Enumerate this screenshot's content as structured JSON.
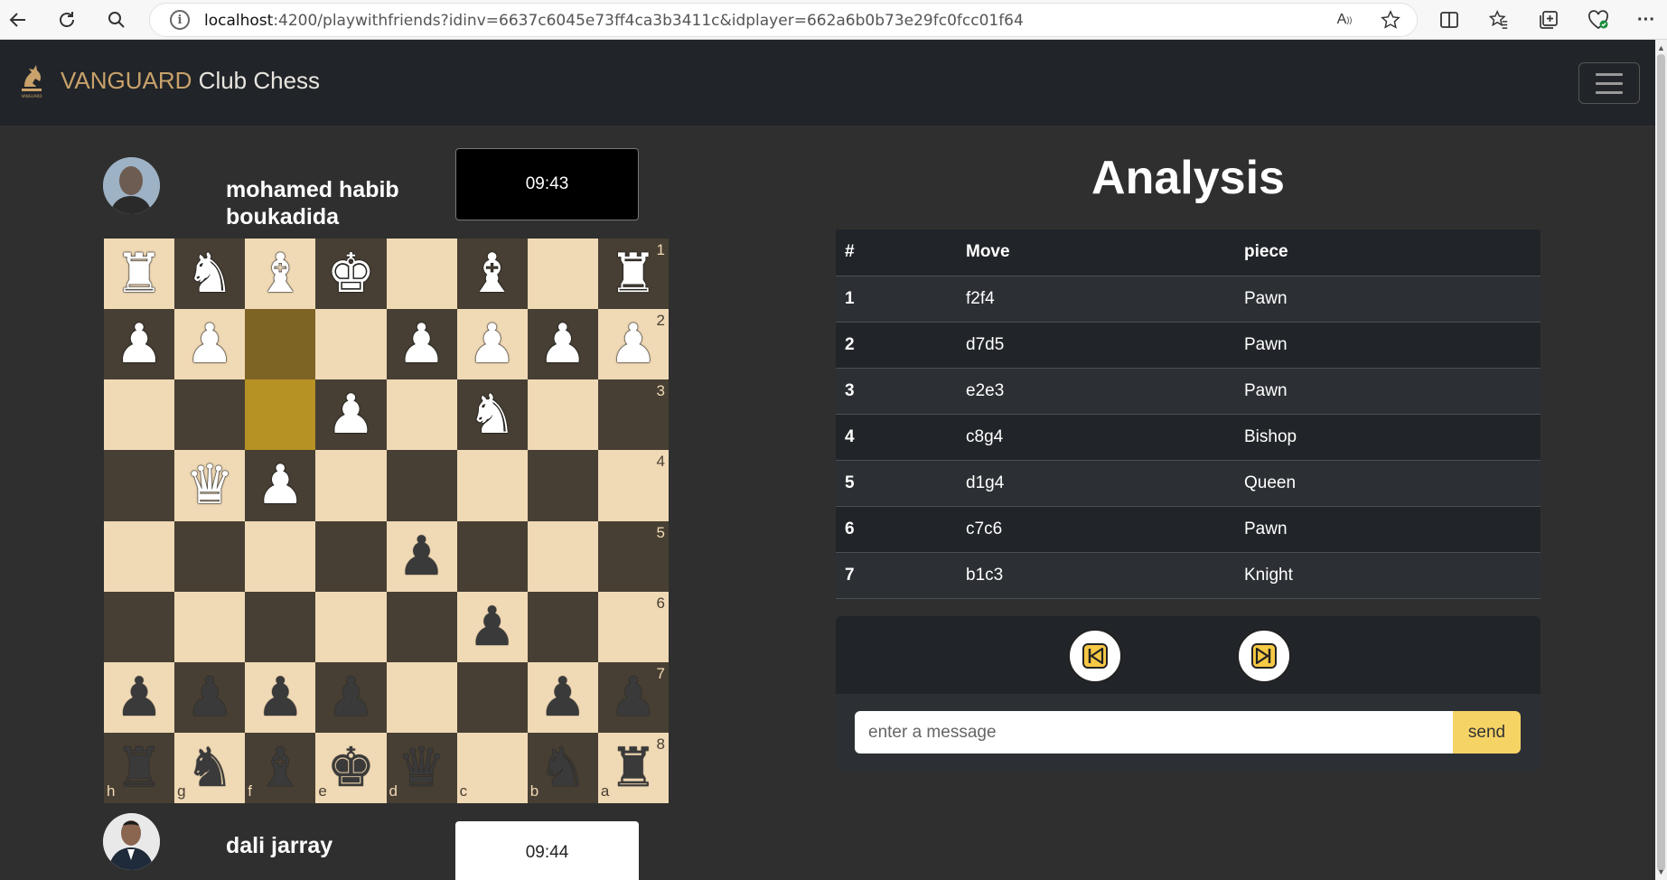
{
  "browser": {
    "url_host": "localhost",
    "url_rest": ":4200/playwithfriends?idinv=6637c6045e73ff4ca3b3411c&idplayer=662a6b0b73e29fc0fcc01f64",
    "icons": [
      "back-arrow-icon",
      "reload-icon",
      "search-icon",
      "info-icon",
      "read-aloud-icon",
      "star-icon",
      "split-screen-icon",
      "favorites-icon",
      "collections-icon",
      "health-icon",
      "more-icon"
    ]
  },
  "navbar": {
    "brand_part1": "VANGUARD",
    "brand_part2": " Club Chess",
    "logo_text": "VANGUARD"
  },
  "players": {
    "top": {
      "name_line1": "mohamed habib",
      "name_line2": "boukadida",
      "clock": "09:43"
    },
    "bottom": {
      "name": "dali jarray",
      "clock": "09:44"
    }
  },
  "board": {
    "rows": [
      [
        "R",
        "N",
        "B",
        "K",
        "",
        "B",
        "",
        "R"
      ],
      [
        "P",
        "P",
        "",
        "",
        "P",
        "P",
        "P",
        "P"
      ],
      [
        "",
        "",
        "",
        "P",
        "",
        "N",
        "",
        ""
      ],
      [
        "",
        "Q",
        "P",
        "",
        "",
        "",
        "",
        ""
      ],
      [
        "",
        "",
        "",
        "",
        "p",
        "",
        "",
        ""
      ],
      [
        "",
        "",
        "",
        "",
        "",
        "p",
        "",
        ""
      ],
      [
        "p",
        "p",
        "p",
        "p",
        "",
        "",
        "p",
        "p"
      ],
      [
        "r",
        "n",
        "b",
        "k",
        "q",
        "",
        "n",
        "r"
      ]
    ],
    "highlighted": [
      [
        1,
        2
      ],
      [
        2,
        2
      ]
    ],
    "rank_labels": [
      "1",
      "2",
      "3",
      "4",
      "5",
      "6",
      "7",
      "8"
    ],
    "file_labels": [
      "h",
      "g",
      "f",
      "e",
      "d",
      "c",
      "b",
      "a"
    ]
  },
  "analysis": {
    "title": "Analysis",
    "headers": [
      "#",
      "Move",
      "piece"
    ],
    "rows": [
      [
        "1",
        "f2f4",
        "Pawn"
      ],
      [
        "2",
        "d7d5",
        "Pawn"
      ],
      [
        "3",
        "e2e3",
        "Pawn"
      ],
      [
        "4",
        "c8g4",
        "Bishop"
      ],
      [
        "5",
        "d1g4",
        "Queen"
      ],
      [
        "6",
        "c7c6",
        "Pawn"
      ],
      [
        "7",
        "b1c3",
        "Knight"
      ]
    ]
  },
  "chat": {
    "placeholder": "enter a message",
    "send_label": "send"
  },
  "colors": {
    "light_square": "#f0d9b5",
    "dark_square": "#473f33",
    "highlight_dark": "#7d6425",
    "highlight_light": "#b69124",
    "brand_gold": "#c9a26b",
    "send_yellow": "#f6d365"
  }
}
